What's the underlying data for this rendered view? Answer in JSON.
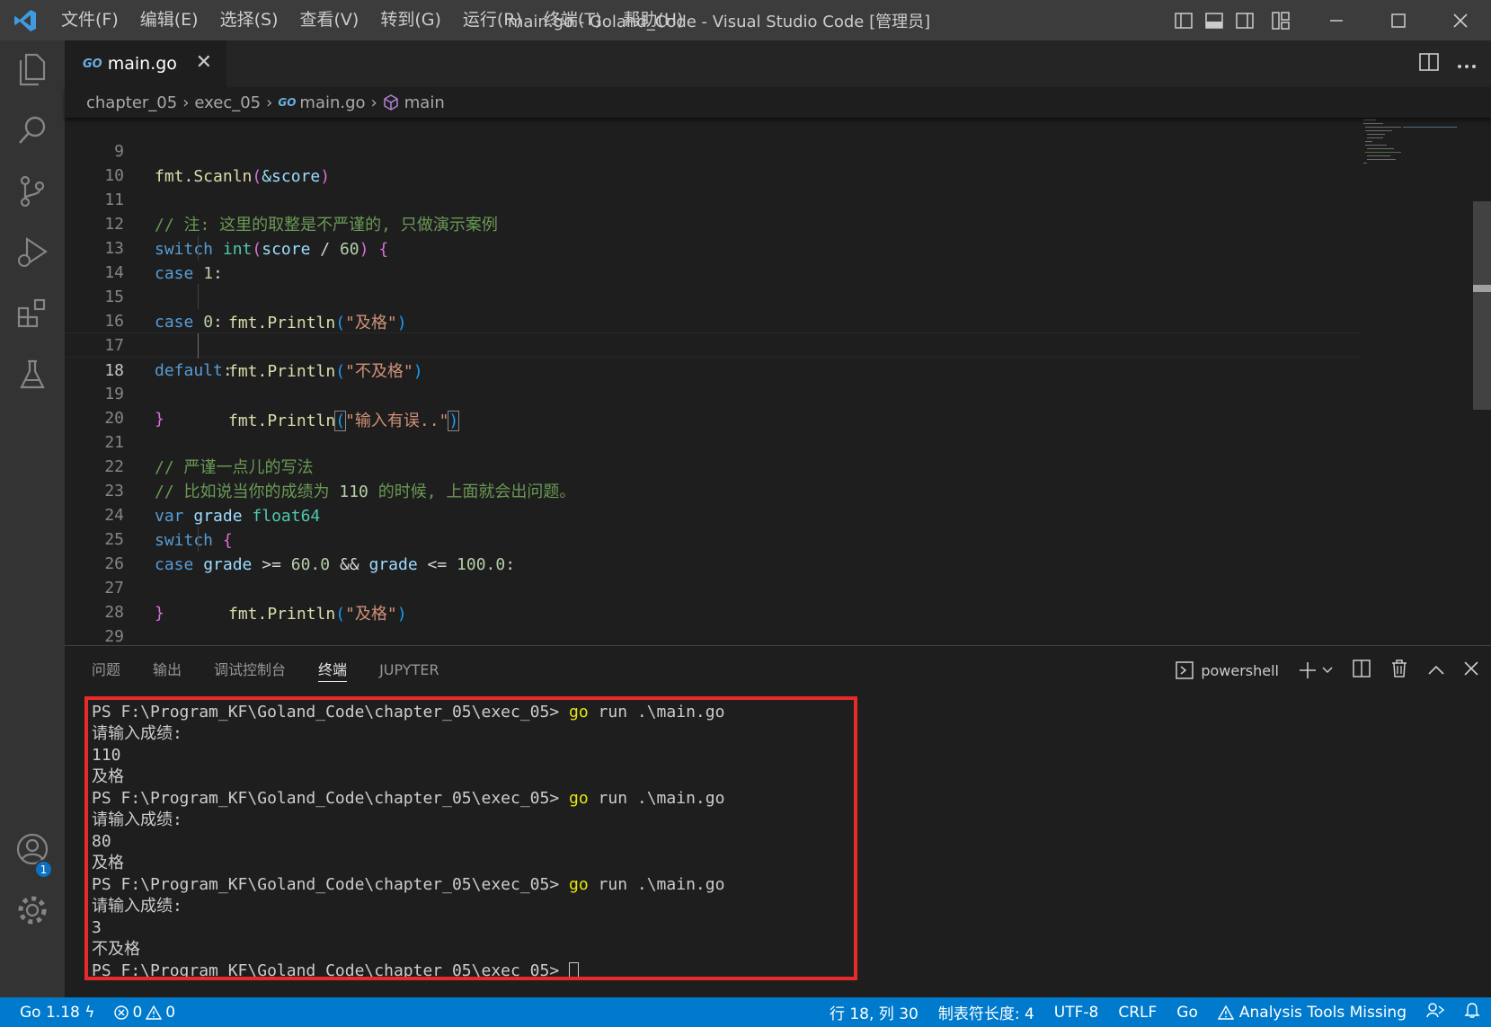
{
  "window": {
    "title": "main.go - Goland_Code - Visual Studio Code [管理员]",
    "menu": [
      "文件(F)",
      "编辑(E)",
      "选择(S)",
      "查看(V)",
      "转到(G)",
      "运行(R)",
      "终端(T)",
      "帮助(H)"
    ]
  },
  "tab": {
    "go_badge": "GO",
    "label": "main.go",
    "close": "✕"
  },
  "breadcrumb": {
    "items": [
      "chapter_05",
      "exec_05",
      "main.go",
      "main"
    ],
    "go_badge": "GO"
  },
  "editor": {
    "line_numbers": [
      "9",
      "10",
      "11",
      "12",
      "13",
      "14",
      "15",
      "16",
      "17",
      "18",
      "19",
      "20",
      "21",
      "22",
      "23",
      "24",
      "25",
      "26",
      "27",
      "28",
      "29"
    ],
    "active_line": "18",
    "strings": {
      "l9_fn": "fmt.Scanln",
      "l9_arg": "&score",
      "l11_comment": "// 注: 这里的取整是不严谨的, 只做演示案例",
      "l12_switch": "switch",
      "l12_int": "int",
      "l12_var": "score",
      "l12_op": " / ",
      "l12_num": "60",
      "l13_case": "case",
      "l13_num": "1",
      "l14_fn": "fmt.Println",
      "l14_str": "\"及格\"",
      "l15_case": "case",
      "l15_num": "0",
      "l16_fn": "fmt.Println",
      "l16_str": "\"不及格\"",
      "l17_default": "default",
      "l18_fn": "fmt.Println",
      "l18_str": "\"输入有误..\"",
      "l21_comment": "// 严谨一点儿的写法",
      "l22_comment_a": "// 比如说当你的成绩为 ",
      "l22_num": "110",
      "l22_comment_b": " 的时候, 上面就会出问题。",
      "l23_var": "var",
      "l23_name": "grade",
      "l23_type": "float64",
      "l24_switch": "switch",
      "l25_case": "case",
      "l25_grade1": "grade",
      "l25_op1": " >= ",
      "l25_num1": "60.0",
      "l25_and": " && ",
      "l25_grade2": "grade",
      "l25_op2": " <= ",
      "l25_num2": "100.0",
      "l26_fn": "fmt.Println",
      "l26_str": "\"及格\""
    }
  },
  "panel": {
    "tabs": [
      "问题",
      "输出",
      "调试控制台",
      "终端",
      "JUPYTER"
    ],
    "active_tab": "终端",
    "shell": "powershell",
    "terminal": {
      "prompt": "PS F:\\Program_KF\\Goland_Code\\chapter_05\\exec_05>",
      "command_go": "go",
      "command_rest": " run .\\main.go",
      "ask": "请输入成绩:",
      "runs": [
        {
          "input": "110",
          "output": "及格"
        },
        {
          "input": "80",
          "output": "及格"
        },
        {
          "input": "3",
          "output": "不及格"
        }
      ]
    }
  },
  "statusbar": {
    "go_version": "Go 1.18",
    "errors": "0",
    "warnings": "0",
    "position": "行 18, 列 30",
    "tab_size": "制表符长度: 4",
    "encoding": "UTF-8",
    "eol": "CRLF",
    "language": "Go",
    "analysis": "Analysis Tools Missing"
  },
  "colors": {
    "accent": "#007acc",
    "highlight_box": "#e82a2a"
  }
}
